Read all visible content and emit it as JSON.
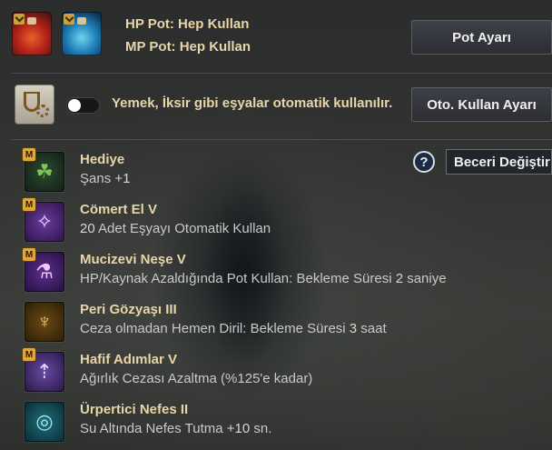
{
  "pots": {
    "hp_label": "HP Pot: Hep Kullan",
    "mp_label": "MP Pot: Hep Kullan",
    "settings_button": "Pot Ayarı",
    "hp_icon": "red-potion-icon",
    "mp_icon": "blue-potion-icon"
  },
  "auto_use": {
    "description": "Yemek, İksir gibi eşyalar otomatik kullanılır.",
    "toggle_on": false,
    "settings_button": "Oto. Kullan Ayarı",
    "icon": "flask-gear-icon"
  },
  "skill_controls": {
    "help_label": "?",
    "dropdown_value": "Beceri Değiştir"
  },
  "skills": [
    {
      "badge": "M",
      "icon": "clover-icon",
      "icon_glyph": "☘",
      "name": "Hediye",
      "desc_pre": "Şans ",
      "desc_num": "+1",
      "desc_post": ""
    },
    {
      "badge": "M",
      "icon": "fairy-icon",
      "icon_glyph": "✧",
      "name": "Cömert El V",
      "desc_pre": "",
      "desc_num": "20",
      "desc_post": " Adet Eşyayı Otomatik Kullan"
    },
    {
      "badge": "M",
      "icon": "potion-plus-icon",
      "icon_glyph": "⚗",
      "name": "Mucizevi Neşe V",
      "desc_pre": "HP/Kaynak Azaldığında Pot Kullan: Bekleme Süresi ",
      "desc_num": "2",
      "desc_post": " saniye"
    },
    {
      "badge": "",
      "icon": "tear-vial-icon",
      "icon_glyph": "♆",
      "name": "Peri Gözyaşı III",
      "desc_pre": "Ceza olmadan Hemen Diril: Bekleme Süresi ",
      "desc_num": "3",
      "desc_post": " saat"
    },
    {
      "badge": "M",
      "icon": "weight-icon",
      "icon_glyph": "⇡",
      "name": "Hafif Adımlar V",
      "desc_pre": "Ağırlık Cezası Azaltma (%125'e kadar)",
      "desc_num": "",
      "desc_post": ""
    },
    {
      "badge": "",
      "icon": "bubbles-icon",
      "icon_glyph": "◎",
      "name": "Ürpertici Nefes II",
      "desc_pre": "Su Altında Nefes Tutma ",
      "desc_num": "+10",
      "desc_post": " sn."
    }
  ]
}
